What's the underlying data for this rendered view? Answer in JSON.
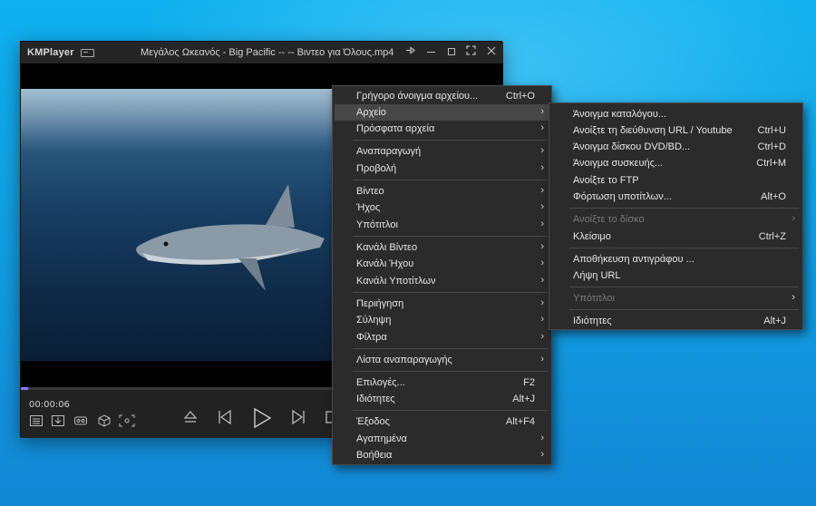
{
  "player": {
    "logo": "KMPlayer",
    "title": "Μεγάλος Ωκεανός - Big Pacific --  -- Βιντεο για Όλους.mp4",
    "time": "00:00:06",
    "progress_fraction": 0.015
  },
  "main_menu": {
    "items": [
      {
        "label": "Γρήγορο άνοιγμα αρχείου...",
        "shortcut": "Ctrl+O"
      },
      {
        "label": "Αρχείο",
        "arrow": "›"
      },
      {
        "label": "Πρόσφατα αρχεία",
        "arrow": "›"
      },
      {
        "label": "Αναπαραγωγή",
        "arrow": "›"
      },
      {
        "label": "Προβολή",
        "arrow": "›"
      },
      {
        "label": "Βίντεο",
        "arrow": "›"
      },
      {
        "label": "Ήχος",
        "arrow": "›"
      },
      {
        "label": "Υπότιτλοι",
        "arrow": "›"
      },
      {
        "label": "Κανάλι Βίντεο",
        "arrow": "›"
      },
      {
        "label": "Κανάλι Ήχου",
        "arrow": "›"
      },
      {
        "label": "Κανάλι Υποτίτλων",
        "arrow": "›"
      },
      {
        "label": "Περιήγηση",
        "arrow": "›"
      },
      {
        "label": "Σύληψη",
        "arrow": "›"
      },
      {
        "label": "Φίλτρα",
        "arrow": "›"
      },
      {
        "label": "Λίστα αναπαραγωγής",
        "arrow": "›"
      },
      {
        "label": "Επιλογές...",
        "shortcut": "F2"
      },
      {
        "label": "Ιδιότητες",
        "shortcut": "Alt+J"
      },
      {
        "label": "Έξοδος",
        "shortcut": "Alt+F4"
      },
      {
        "label": "Αγαπημένα",
        "arrow": "›"
      },
      {
        "label": "Βοήθεια",
        "arrow": "›"
      }
    ]
  },
  "file_submenu": {
    "items": [
      {
        "label": "Άνοιγμα καταλόγου..."
      },
      {
        "label": "Ανοίξτε τη διεύθυνση URL / Youtube",
        "shortcut": "Ctrl+U"
      },
      {
        "label": "Άνοιγμα δίσκου DVD/BD...",
        "shortcut": "Ctrl+D"
      },
      {
        "label": "Άνοιγμα συσκευής...",
        "shortcut": "Ctrl+M"
      },
      {
        "label": "Ανοίξτε το FTP"
      },
      {
        "label": "Φόρτωση υποτίτλων...",
        "shortcut": "Alt+O"
      },
      {
        "label": "Ανοίξτε το δίσκο",
        "arrow": "›"
      },
      {
        "label": "Κλείσιμο",
        "shortcut": "Ctrl+Z"
      },
      {
        "label": "Αποθήκευση αντιγράφου ..."
      },
      {
        "label": "Λήψη URL"
      },
      {
        "label": "Υπότιτλοι",
        "arrow": "›"
      },
      {
        "label": "Ιδιότητες",
        "shortcut": "Alt+J"
      }
    ]
  },
  "colors": {
    "desktop": "#109fe2",
    "menu_bg": "#2b2b2b",
    "menu_highlight": "#474747",
    "seek_fill": "#7d7dff"
  }
}
